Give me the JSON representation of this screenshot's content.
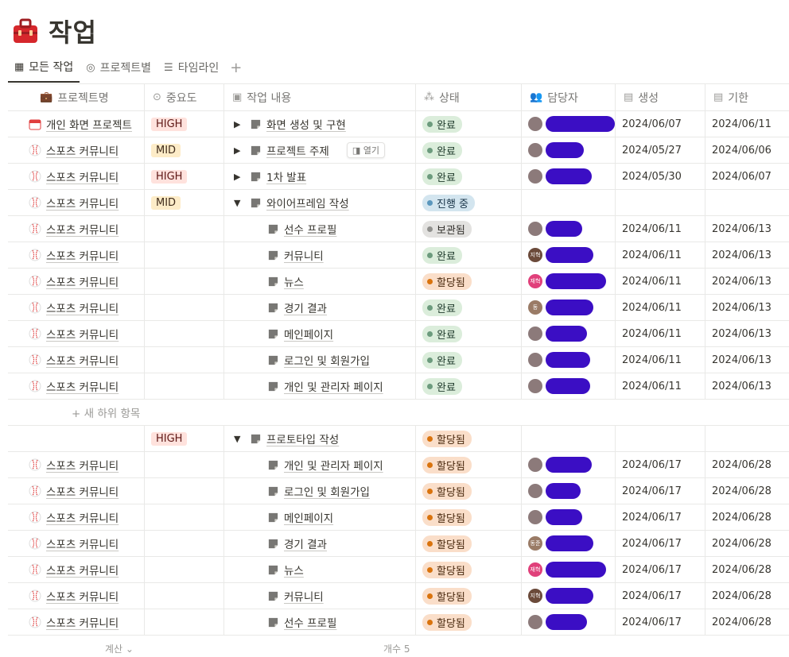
{
  "title": "작업",
  "views": [
    {
      "label": "모든 작업",
      "icon": "table-icon"
    },
    {
      "label": "프로젝트별",
      "icon": "target-icon"
    },
    {
      "label": "타임라인",
      "icon": "timeline-icon"
    }
  ],
  "add_view": "+",
  "columns": [
    {
      "label": "프로젝트명",
      "icon": "briefcase-icon",
      "glyph": "💼"
    },
    {
      "label": "중요도",
      "icon": "select-icon",
      "glyph": "⊙"
    },
    {
      "label": "작업 내용",
      "icon": "title-icon",
      "glyph": "▣"
    },
    {
      "label": "상태",
      "icon": "status-icon",
      "glyph": "⁂"
    },
    {
      "label": "담당자",
      "icon": "people-icon",
      "glyph": "👥"
    },
    {
      "label": "생성",
      "icon": "calendar-icon",
      "glyph": "▤"
    },
    {
      "label": "기한",
      "icon": "calendar-icon",
      "glyph": "▤"
    }
  ],
  "open_label": "열기",
  "new_subitem": "+ 새 하위 항목",
  "footer": {
    "left": "계산 ⌄",
    "right": "개수 5"
  },
  "rows": [
    {
      "project": "개인 화면 프로젝트",
      "project_icon": "calendar",
      "priority": "HIGH",
      "toggle": "▶",
      "task": "화면 생성 및 구현",
      "sub": false,
      "status": "완료",
      "status_type": "done",
      "avatar": "",
      "created": "2024/06/07",
      "due": "2024/06/11"
    },
    {
      "project": "스포츠 커뮤니티",
      "project_icon": "baseball",
      "priority": "MID",
      "toggle": "▶",
      "task": "프로젝트 주제",
      "sub": false,
      "open": true,
      "status": "완료",
      "status_type": "done",
      "avatar": "",
      "created": "2024/05/27",
      "due": "2024/06/06"
    },
    {
      "project": "스포츠 커뮤니티",
      "project_icon": "baseball",
      "priority": "HIGH",
      "toggle": "▶",
      "task": "1차 발표",
      "sub": false,
      "status": "완료",
      "status_type": "done",
      "avatar": "",
      "created": "2024/05/30",
      "due": "2024/06/07"
    },
    {
      "project": "스포츠 커뮤니티",
      "project_icon": "baseball",
      "priority": "MID",
      "toggle": "▼",
      "task": "와이어프레임 작성",
      "sub": false,
      "status": "진행 중",
      "status_type": "prog",
      "avatar": null,
      "created": "",
      "due": ""
    },
    {
      "project": "스포츠 커뮤니티",
      "project_icon": "baseball",
      "priority": "",
      "task": "선수 프로필",
      "sub": true,
      "status": "보관됨",
      "status_type": "arch",
      "avatar": "",
      "created": "2024/06/11",
      "due": "2024/06/13"
    },
    {
      "project": "스포츠 커뮤니티",
      "project_icon": "baseball",
      "priority": "",
      "task": "커뮤니티",
      "sub": true,
      "status": "완료",
      "status_type": "done",
      "avatar": "지혁",
      "created": "2024/06/11",
      "due": "2024/06/13"
    },
    {
      "project": "스포츠 커뮤니티",
      "project_icon": "baseball",
      "priority": "",
      "task": "뉴스",
      "sub": true,
      "status": "할당됨",
      "status_type": "assign",
      "avatar": "재혁",
      "created": "2024/06/11",
      "due": "2024/06/13"
    },
    {
      "project": "스포츠 커뮤니티",
      "project_icon": "baseball",
      "priority": "",
      "task": "경기 결과",
      "sub": true,
      "status": "완료",
      "status_type": "done",
      "avatar": "동",
      "created": "2024/06/11",
      "due": "2024/06/13"
    },
    {
      "project": "스포츠 커뮤니티",
      "project_icon": "baseball",
      "priority": "",
      "task": "메인페이지",
      "sub": true,
      "status": "완료",
      "status_type": "done",
      "avatar": "",
      "created": "2024/06/11",
      "due": "2024/06/13"
    },
    {
      "project": "스포츠 커뮤니티",
      "project_icon": "baseball",
      "priority": "",
      "task": "로그인 및 회원가입",
      "sub": true,
      "status": "완료",
      "status_type": "done",
      "avatar": "",
      "created": "2024/06/11",
      "due": "2024/06/13"
    },
    {
      "project": "스포츠 커뮤니티",
      "project_icon": "baseball",
      "priority": "",
      "task": "개인 및 관리자 페이지",
      "sub": true,
      "status": "완료",
      "status_type": "done",
      "avatar": "",
      "created": "2024/06/11",
      "due": "2024/06/13"
    },
    {
      "new_subitem": true
    },
    {
      "project": "",
      "project_icon": "",
      "priority": "HIGH",
      "toggle": "▼",
      "task": "프로토타입 작성",
      "sub": false,
      "status": "할당됨",
      "status_type": "assign",
      "avatar": null,
      "created": "",
      "due": ""
    },
    {
      "project": "스포츠 커뮤니티",
      "project_icon": "baseball",
      "priority": "",
      "task": "개인 및 관리자 페이지",
      "sub": true,
      "status": "할당됨",
      "status_type": "assign",
      "avatar": "",
      "created": "2024/06/17",
      "due": "2024/06/28"
    },
    {
      "project": "스포츠 커뮤니티",
      "project_icon": "baseball",
      "priority": "",
      "task": "로그인 및 회원가입",
      "sub": true,
      "status": "할당됨",
      "status_type": "assign",
      "avatar": "",
      "created": "2024/06/17",
      "due": "2024/06/28"
    },
    {
      "project": "스포츠 커뮤니티",
      "project_icon": "baseball",
      "priority": "",
      "task": "메인페이지",
      "sub": true,
      "status": "할당됨",
      "status_type": "assign",
      "avatar": "",
      "created": "2024/06/17",
      "due": "2024/06/28"
    },
    {
      "project": "스포츠 커뮤니티",
      "project_icon": "baseball",
      "priority": "",
      "task": "경기 결과",
      "sub": true,
      "status": "할당됨",
      "status_type": "assign",
      "avatar": "동준",
      "created": "2024/06/17",
      "due": "2024/06/28"
    },
    {
      "project": "스포츠 커뮤니티",
      "project_icon": "baseball",
      "priority": "",
      "task": "뉴스",
      "sub": true,
      "status": "할당됨",
      "status_type": "assign",
      "avatar": "재혁",
      "created": "2024/06/17",
      "due": "2024/06/28"
    },
    {
      "project": "스포츠 커뮤니티",
      "project_icon": "baseball",
      "priority": "",
      "task": "커뮤니티",
      "sub": true,
      "status": "할당됨",
      "status_type": "assign",
      "avatar": "지혁",
      "created": "2024/06/17",
      "due": "2024/06/28"
    },
    {
      "project": "스포츠 커뮤니티",
      "project_icon": "baseball",
      "priority": "",
      "task": "선수 프로필",
      "sub": true,
      "status": "할당됨",
      "status_type": "assign",
      "avatar": "",
      "created": "2024/06/17",
      "due": "2024/06/28"
    }
  ]
}
